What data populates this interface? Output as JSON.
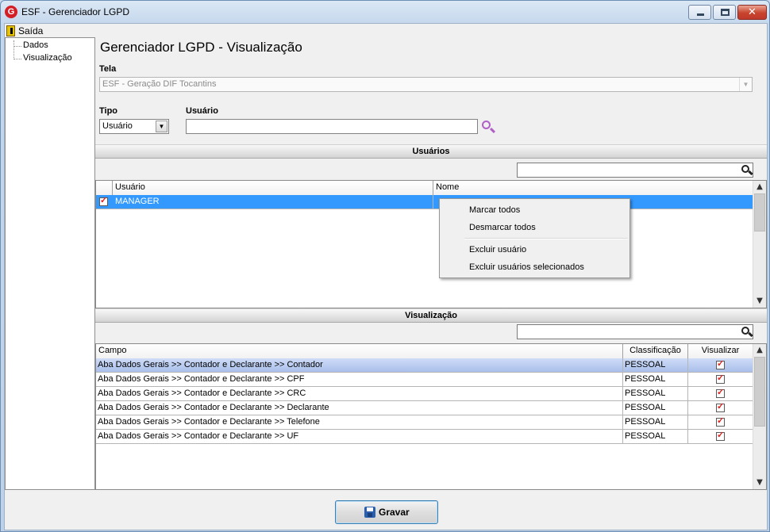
{
  "window": {
    "title": "ESF - Gerenciador LGPD",
    "logo_letter": "G"
  },
  "menu": {
    "exit_label": "Saída"
  },
  "tree": {
    "items": [
      {
        "label": "Dados"
      },
      {
        "label": "Visualização"
      }
    ]
  },
  "page": {
    "title": "Gerenciador LGPD - Visualização"
  },
  "form": {
    "screen_label": "Tela",
    "screen_value": "ESF - Geração DIF Tocantins",
    "type_label": "Tipo",
    "type_value": "Usuário",
    "user_label": "Usuário",
    "user_value": ""
  },
  "users_section": {
    "header": "Usuários",
    "filter_value": "",
    "columns": [
      "Usuário",
      "Nome"
    ],
    "rows": [
      {
        "checked": true,
        "user": "MANAGER",
        "name": ""
      }
    ]
  },
  "context_menu": {
    "items": [
      "Marcar todos",
      "Desmarcar todos",
      "Excluir usuário",
      "Excluir usuários selecionados"
    ]
  },
  "view_section": {
    "header": "Visualização",
    "filter_value": "",
    "columns": [
      "Campo",
      "Classificação",
      "Visualizar"
    ],
    "rows": [
      {
        "field": "Aba Dados Gerais >> Contador e Declarante >> Contador",
        "class": "PESSOAL",
        "visible": true
      },
      {
        "field": "Aba Dados Gerais >> Contador e Declarante >> CPF",
        "class": "PESSOAL",
        "visible": true
      },
      {
        "field": "Aba Dados Gerais >> Contador e Declarante >> CRC",
        "class": "PESSOAL",
        "visible": true
      },
      {
        "field": "Aba Dados Gerais >> Contador e Declarante >> Declarante",
        "class": "PESSOAL",
        "visible": true
      },
      {
        "field": "Aba Dados Gerais >> Contador e Declarante >> Telefone",
        "class": "PESSOAL",
        "visible": true
      },
      {
        "field": "Aba Dados Gerais >> Contador e Declarante >> UF",
        "class": "PESSOAL",
        "visible": true
      }
    ]
  },
  "footer": {
    "save_label": "Gravar"
  },
  "colors": {
    "selection_blue": "#3399ff",
    "checkmark_red": "#e0201d",
    "search_icon_purple": "#b05fc7"
  }
}
